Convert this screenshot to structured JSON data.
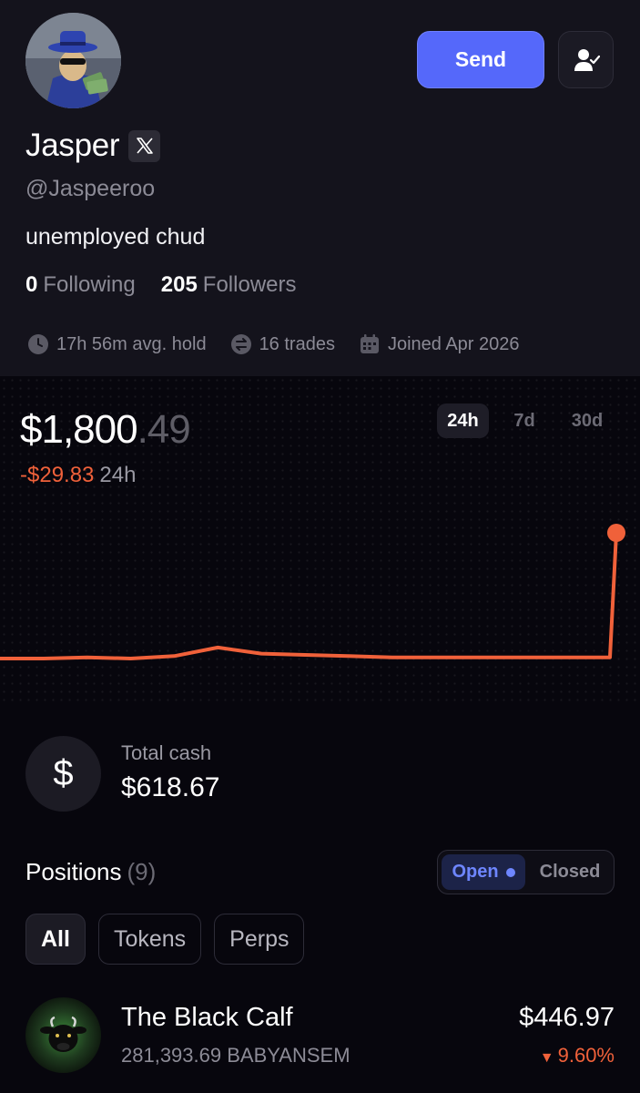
{
  "profile": {
    "name": "Jasper",
    "handle": "@Jaspeeroo",
    "bio": "unemployed chud",
    "following_count": "0",
    "following_label": "Following",
    "followers_count": "205",
    "followers_label": "Followers",
    "send_label": "Send",
    "stats": {
      "avg_hold": "17h 56m avg. hold",
      "trades": "16 trades",
      "joined": "Joined Apr 2026"
    }
  },
  "balance": {
    "whole": "$1,800",
    "cents": ".49",
    "change": "-$29.83",
    "change_period": "24h",
    "ranges": [
      "24h",
      "7d",
      "30d"
    ],
    "active_range": "24h"
  },
  "chart_data": {
    "type": "line",
    "series": [
      {
        "values": [
          1790.2,
          1790.2,
          1790.3,
          1790.2,
          1790.4,
          1791.1,
          1790.6,
          1790.5,
          1790.4,
          1790.3,
          1790.3,
          1790.3,
          1790.3,
          1790.3,
          1790.3,
          1800.49
        ]
      }
    ],
    "line_color": "#f0613a",
    "grid": false
  },
  "cash": {
    "icon": "dollar-icon",
    "label": "Total cash",
    "value": "$618.67"
  },
  "positions": {
    "title": "Positions",
    "count": "(9)",
    "toggle": {
      "open": "Open",
      "closed": "Closed",
      "active": "Open"
    },
    "filters": [
      "All",
      "Tokens",
      "Perps"
    ],
    "active_filter": "All",
    "items": [
      {
        "name": "The Black Calf",
        "amount": "281,393.69 BABYANSEM",
        "value": "$446.97",
        "change": "9.60%",
        "direction": "down"
      }
    ]
  },
  "colors": {
    "accent": "#5568fa",
    "negative": "#f0613a",
    "background": "#07060d",
    "panel": "#14131c"
  }
}
